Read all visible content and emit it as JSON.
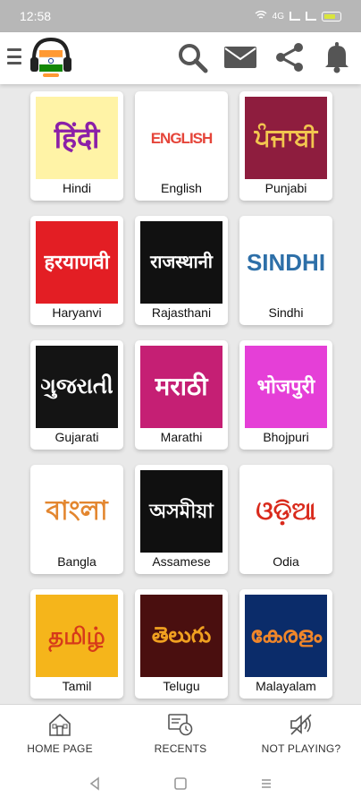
{
  "status_bar": {
    "time": "12:58",
    "network": "4G",
    "battery": "80"
  },
  "app_bar": {
    "menu_icon": "hamburger-menu-icon",
    "logo": "radio-headphones-india-flag-logo",
    "actions": [
      "search-icon",
      "mail-icon",
      "share-icon",
      "notification-bell-icon"
    ]
  },
  "tiles": [
    {
      "label": "Hindi",
      "art": "हिंदी",
      "bg": "#fff3a6",
      "fg": "#8b1fa8"
    },
    {
      "label": "English",
      "art": "ENGLISH",
      "bg": "#ffffff",
      "fg": "#e5453a"
    },
    {
      "label": "Punjabi",
      "art": "ਪੰਜਾਬੀ",
      "bg": "#8e1d3e",
      "fg": "#f2c64f"
    },
    {
      "label": "Haryanvi",
      "art": "हरयाणवी",
      "bg": "#e31e24",
      "fg": "#ffffff"
    },
    {
      "label": "Rajasthani",
      "art": "राजस्थानी",
      "bg": "#111111",
      "fg": "#ffffff"
    },
    {
      "label": "Sindhi",
      "art": "SINDHI",
      "bg": "#ffffff",
      "fg": "#2d6fa8"
    },
    {
      "label": "Gujarati",
      "art": "ગુજરાતી",
      "bg": "#141414",
      "fg": "#ffffff"
    },
    {
      "label": "Marathi",
      "art": "मराठी",
      "bg": "#c51f74",
      "fg": "#ffffff"
    },
    {
      "label": "Bhojpuri",
      "art": "भोजपुरी",
      "bg": "#e53fd7",
      "fg": "#ffffff"
    },
    {
      "label": "Bangla",
      "art": "বাংলা",
      "bg": "#ffffff",
      "fg": "#e3862f"
    },
    {
      "label": "Assamese",
      "art": "অসমীয়া",
      "bg": "#101010",
      "fg": "#ffffff"
    },
    {
      "label": "Odia",
      "art": "ଓଡ଼ିଆ",
      "bg": "#ffffff",
      "fg": "#d92a1c"
    },
    {
      "label": "Tamil",
      "art": "தமிழ்",
      "bg": "#f5b51b",
      "fg": "#d63a1a"
    },
    {
      "label": "Telugu",
      "art": "తెలుగు",
      "bg": "#4a0f0f",
      "fg": "#f0a020"
    },
    {
      "label": "Malayalam",
      "art": "കേരളം",
      "bg": "#0b2c6a",
      "fg": "#f0862a"
    }
  ],
  "bottom_nav": [
    {
      "label": "HOME PAGE",
      "icon": "home-icon"
    },
    {
      "label": "RECENTS",
      "icon": "recents-history-icon"
    },
    {
      "label": "NOT PLAYING?",
      "icon": "speaker-muted-icon"
    }
  ],
  "system_nav": [
    "back-icon",
    "home-square-icon",
    "recents-lines-icon"
  ]
}
